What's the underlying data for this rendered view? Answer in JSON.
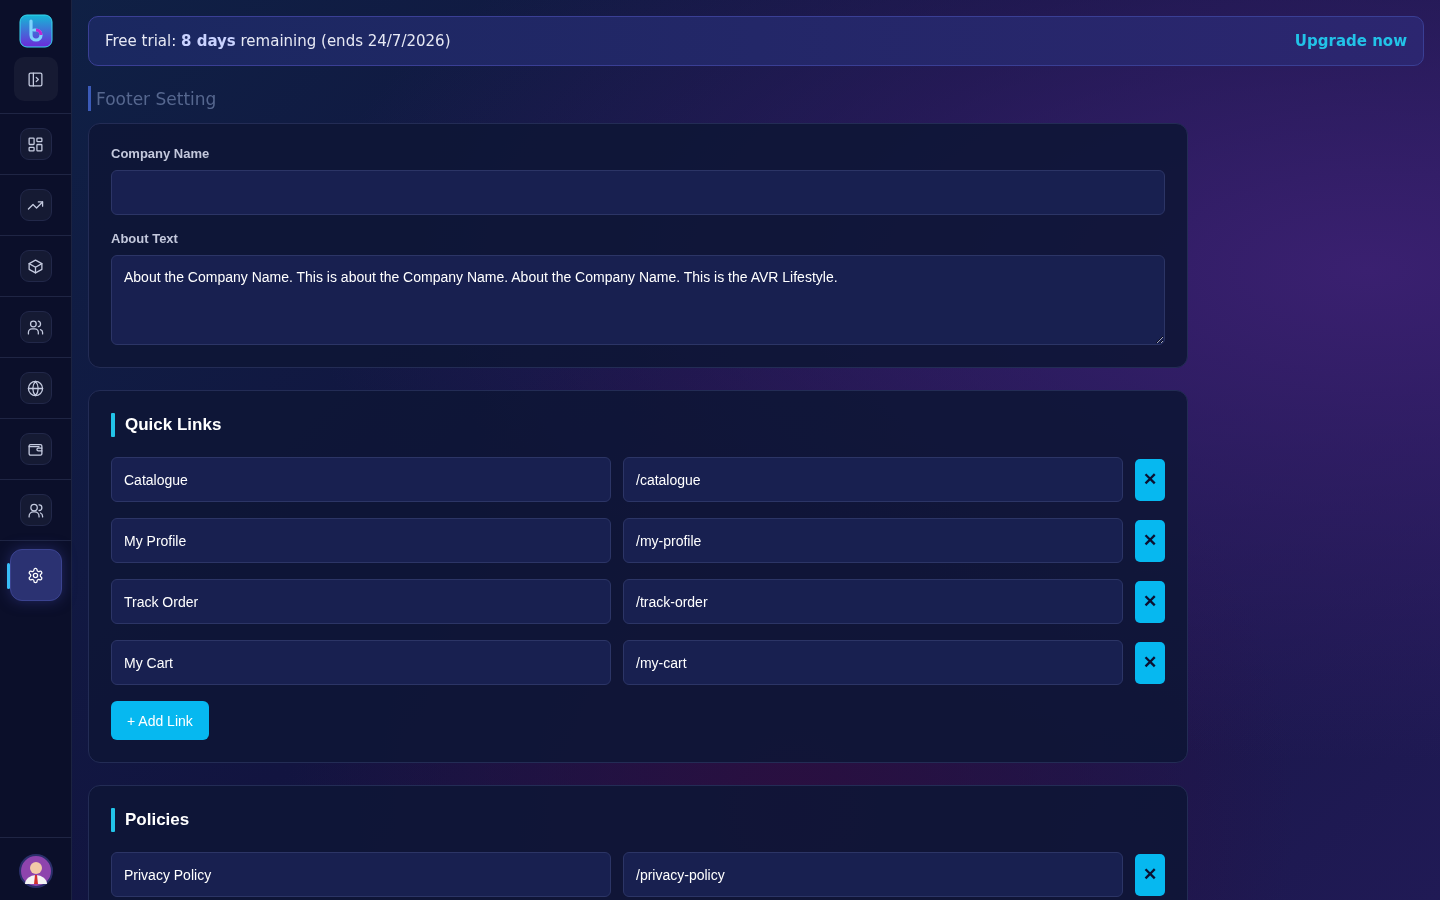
{
  "sidebar": {
    "items": [
      {
        "selected": false
      },
      {
        "selected": false
      },
      {
        "selected": false
      },
      {
        "selected": false
      },
      {
        "selected": false
      },
      {
        "selected": false
      },
      {
        "selected": false
      },
      {
        "selected": true
      }
    ]
  },
  "trial_banner": {
    "text": "Free trial: **8 days** remaining (ends 24/7/2026)",
    "action": "Upgrade now"
  },
  "page_title": "Footer Setting",
  "company": {
    "name_label": "Company Name",
    "about_label": "About Text",
    "about_value": "About the Company Name. This is about the Company Name. About the Company Name. This is the AVR Lifestyle."
  },
  "sections": [
    {
      "title": "Quick Links",
      "rows": [
        {
          "label": "Catalogue",
          "path": "/catalogue",
          "remove": "✕"
        },
        {
          "label": "My Profile",
          "path": "/my-profile",
          "remove": "✕"
        },
        {
          "label": "Track Order",
          "path": "/track-order",
          "remove": "✕"
        },
        {
          "label": "My Cart",
          "path": "/my-cart",
          "remove": "✕"
        }
      ],
      "add_button": "+ Add Link"
    },
    {
      "title": "Policies",
      "rows": [
        {
          "label": "Privacy Policy",
          "path": "/privacy-policy",
          "remove": "✕"
        }
      ]
    }
  ]
}
